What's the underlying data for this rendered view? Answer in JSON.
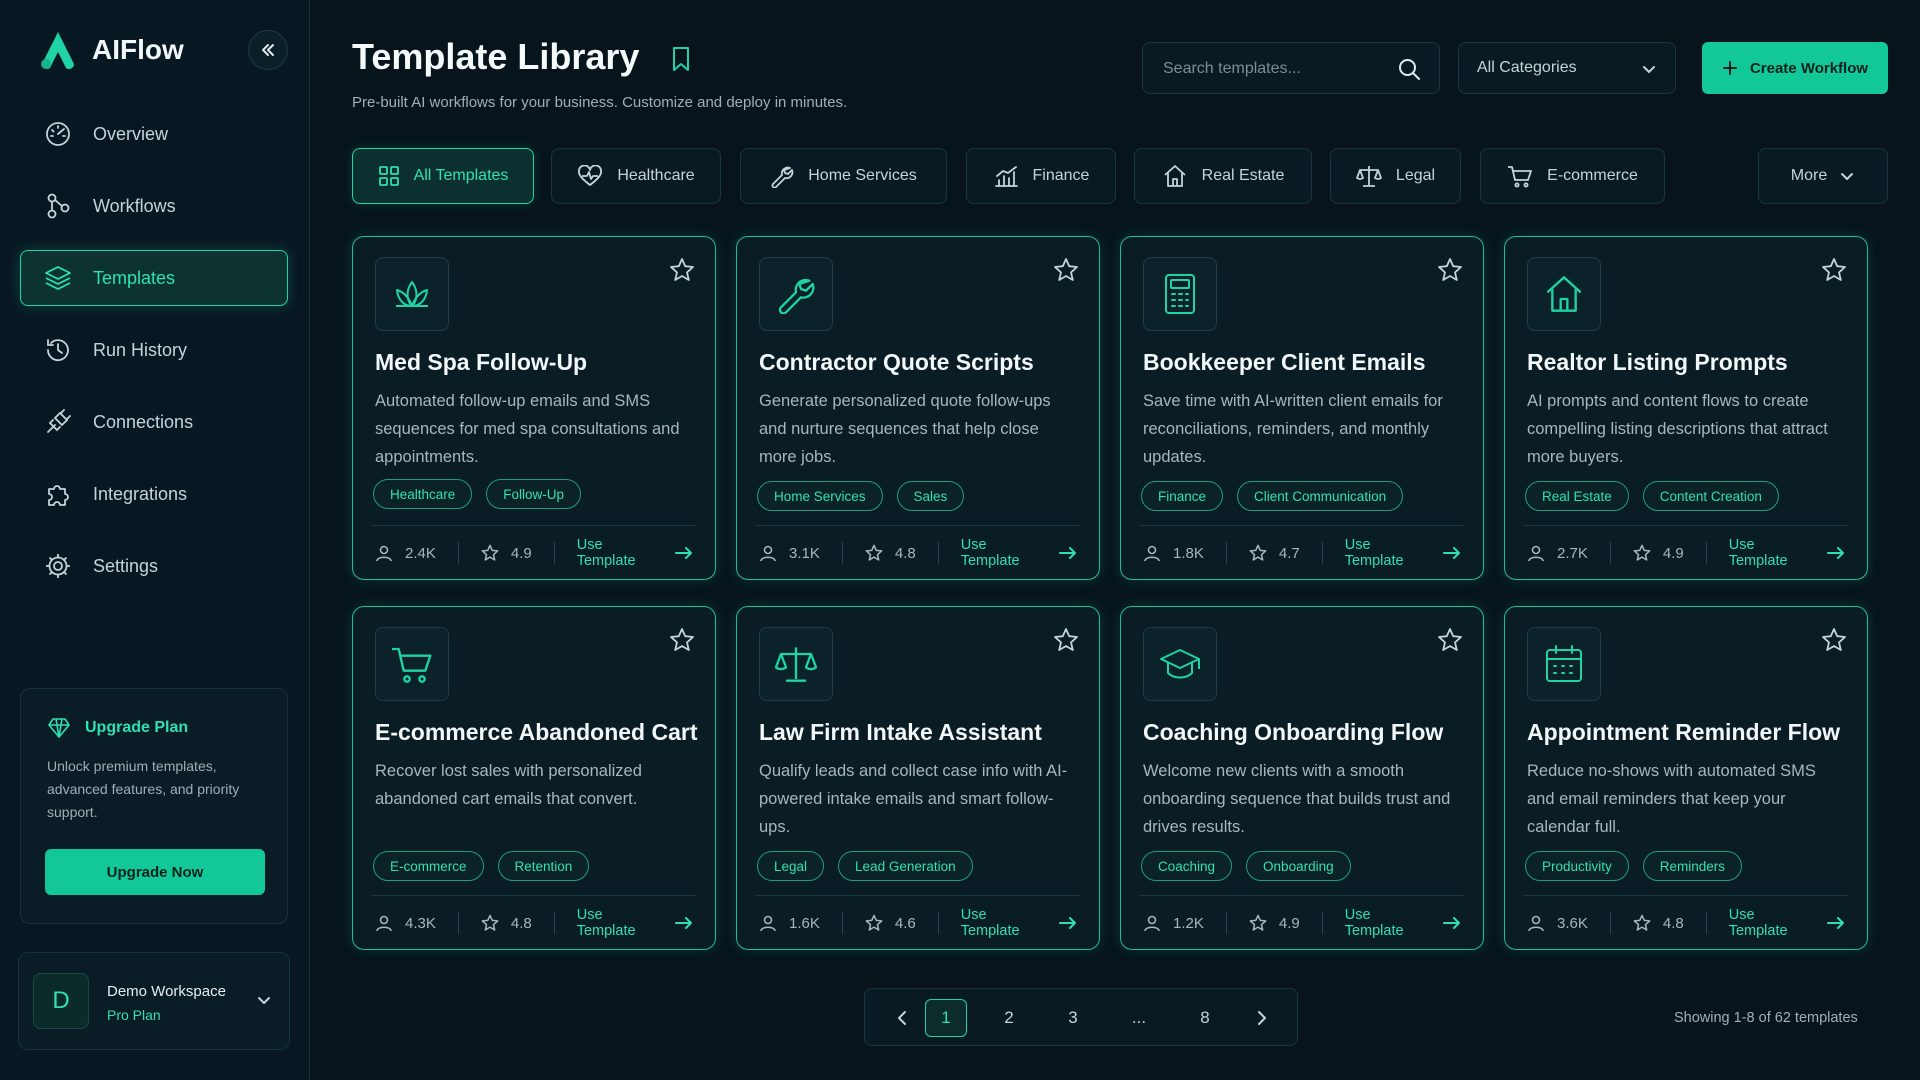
{
  "app": {
    "name": "AIFlow"
  },
  "sidebar": {
    "items": [
      {
        "label": "Overview",
        "icon": "gauge-icon",
        "active": false
      },
      {
        "label": "Workflows",
        "icon": "workflow-icon",
        "active": false
      },
      {
        "label": "Templates",
        "icon": "layers-icon",
        "active": true
      },
      {
        "label": "Run History",
        "icon": "history-icon",
        "active": false
      },
      {
        "label": "Connections",
        "icon": "plug-icon",
        "active": false
      },
      {
        "label": "Integrations",
        "icon": "puzzle-icon",
        "active": false
      },
      {
        "label": "Settings",
        "icon": "gear-icon",
        "active": false
      }
    ],
    "upgrade": {
      "title": "Upgrade Plan",
      "description": "Unlock premium templates, advanced features, and priority support.",
      "button": "Upgrade Now"
    },
    "workspace": {
      "initial": "D",
      "name": "Demo Workspace",
      "plan": "Pro Plan"
    }
  },
  "header": {
    "title": "Template Library",
    "subtitle": "Pre-built AI workflows for your business. Customize and deploy in minutes.",
    "search_placeholder": "Search templates...",
    "category_select": "All Categories",
    "create_button": "Create Workflow"
  },
  "filters": {
    "tabs": [
      {
        "label": "All Templates",
        "icon": "grid-icon",
        "active": true
      },
      {
        "label": "Healthcare",
        "icon": "heart-pulse-icon",
        "active": false
      },
      {
        "label": "Home Services",
        "icon": "wrench-icon",
        "active": false
      },
      {
        "label": "Finance",
        "icon": "chart-icon",
        "active": false
      },
      {
        "label": "Real Estate",
        "icon": "house-icon",
        "active": false
      },
      {
        "label": "Legal",
        "icon": "scale-icon",
        "active": false
      },
      {
        "label": "E-commerce",
        "icon": "cart-icon",
        "active": false
      }
    ],
    "more": "More"
  },
  "templates": [
    {
      "title": "Med Spa Follow-Up",
      "icon": "lotus-icon",
      "description": "Automated follow-up emails and SMS sequences for med spa consultations and appointments.",
      "tags": [
        "Healthcare",
        "Follow-Up"
      ],
      "users": "2.4K",
      "rating": "4.9",
      "action": "Use Template"
    },
    {
      "title": "Contractor Quote Scripts",
      "icon": "wrench-icon",
      "description": "Generate personalized quote follow-ups and nurture sequences that help close more jobs.",
      "tags": [
        "Home Services",
        "Sales"
      ],
      "users": "3.1K",
      "rating": "4.8",
      "action": "Use Template"
    },
    {
      "title": "Bookkeeper Client Emails",
      "icon": "calculator-icon",
      "description": "Save time with AI-written client emails for reconciliations, reminders, and monthly updates.",
      "tags": [
        "Finance",
        "Client Communication"
      ],
      "users": "1.8K",
      "rating": "4.7",
      "action": "Use Template"
    },
    {
      "title": "Realtor Listing Prompts",
      "icon": "house-icon",
      "description": "AI prompts and content flows to create compelling listing descriptions that attract more buyers.",
      "tags": [
        "Real Estate",
        "Content Creation"
      ],
      "users": "2.7K",
      "rating": "4.9",
      "action": "Use Template"
    },
    {
      "title": "E-commerce Abandoned Cart",
      "icon": "cart-icon",
      "description": "Recover lost sales with personalized abandoned cart emails that convert.",
      "tags": [
        "E-commerce",
        "Retention"
      ],
      "users": "4.3K",
      "rating": "4.8",
      "action": "Use Template"
    },
    {
      "title": "Law Firm Intake Assistant",
      "icon": "scale-icon",
      "description": "Qualify leads and collect case info with AI-powered intake emails and smart follow-ups.",
      "tags": [
        "Legal",
        "Lead Generation"
      ],
      "users": "1.6K",
      "rating": "4.6",
      "action": "Use Template"
    },
    {
      "title": "Coaching Onboarding Flow",
      "icon": "graduation-cap-icon",
      "description": "Welcome new clients with a smooth onboarding sequence that builds trust and drives results.",
      "tags": [
        "Coaching",
        "Onboarding"
      ],
      "users": "1.2K",
      "rating": "4.9",
      "action": "Use Template"
    },
    {
      "title": "Appointment Reminder Flow",
      "icon": "calendar-icon",
      "description": "Reduce no-shows with automated SMS and email reminders that keep your calendar full.",
      "tags": [
        "Productivity",
        "Reminders"
      ],
      "users": "3.6K",
      "rating": "4.8",
      "action": "Use Template"
    }
  ],
  "pagination": {
    "pages": [
      "1",
      "2",
      "3",
      "...",
      "8"
    ],
    "current": "1",
    "showing": "Showing 1-8 of 62 templates"
  },
  "colors": {
    "accent": "#1fd3a6",
    "background": "#07141c",
    "surface": "#0a1c24"
  }
}
